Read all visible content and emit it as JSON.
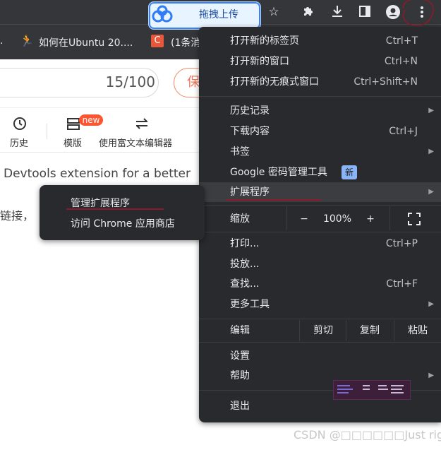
{
  "browser": {
    "upload_extension_label": "拖拽上传",
    "bookmarks": [
      {
        "label": "."
      },
      {
        "label": "如何在Ubuntu 20...."
      },
      {
        "label": "(1条消"
      }
    ]
  },
  "page": {
    "counter": "15/100",
    "save_label": "保",
    "toolbar": [
      {
        "label": "历史",
        "icon": "history-icon"
      },
      {
        "label": "模版",
        "icon": "template-icon",
        "badge": "new"
      },
      {
        "label": "使用富文本编辑器",
        "icon": "switch-icon"
      }
    ],
    "devtools_text": "Devtools extension for a better",
    "link_text": "链接，"
  },
  "menu": {
    "items": {
      "new_tab": {
        "label": "打开新的标签页",
        "shortcut": "Ctrl+T"
      },
      "new_window": {
        "label": "打开新的窗口",
        "shortcut": "Ctrl+N"
      },
      "incognito": {
        "label": "打开新的无痕式窗口",
        "shortcut": "Ctrl+Shift+N"
      },
      "history": {
        "label": "历史记录"
      },
      "downloads": {
        "label": "下载内容",
        "shortcut": "Ctrl+J"
      },
      "bookmarks": {
        "label": "书签"
      },
      "passwords": {
        "label": "Google 密码管理工具",
        "badge": "新"
      },
      "extensions": {
        "label": "扩展程序"
      },
      "zoom": {
        "label": "缩放",
        "minus": "−",
        "value": "100%",
        "plus": "+"
      },
      "print": {
        "label": "打印...",
        "shortcut": "Ctrl+P"
      },
      "cast": {
        "label": "投放..."
      },
      "find": {
        "label": "查找...",
        "shortcut": "Ctrl+F"
      },
      "more_tools": {
        "label": "更多工具"
      },
      "edit": {
        "label": "编辑",
        "cut": "剪切",
        "copy": "复制",
        "paste": "粘贴"
      },
      "settings": {
        "label": "设置"
      },
      "help": {
        "label": "帮助"
      },
      "exit": {
        "label": "退出"
      }
    }
  },
  "submenu": {
    "manage_extensions": "管理扩展程序",
    "visit_store": "访问 Chrome 应用商店"
  },
  "watermark": "CSDN @□□□□□□Just right",
  "colors": {
    "menu_bg": "#292a2d",
    "highlight_row": "#3c3d41",
    "annotation_red": "#8b1a2c",
    "badge_blue": "#8ab4f8"
  }
}
